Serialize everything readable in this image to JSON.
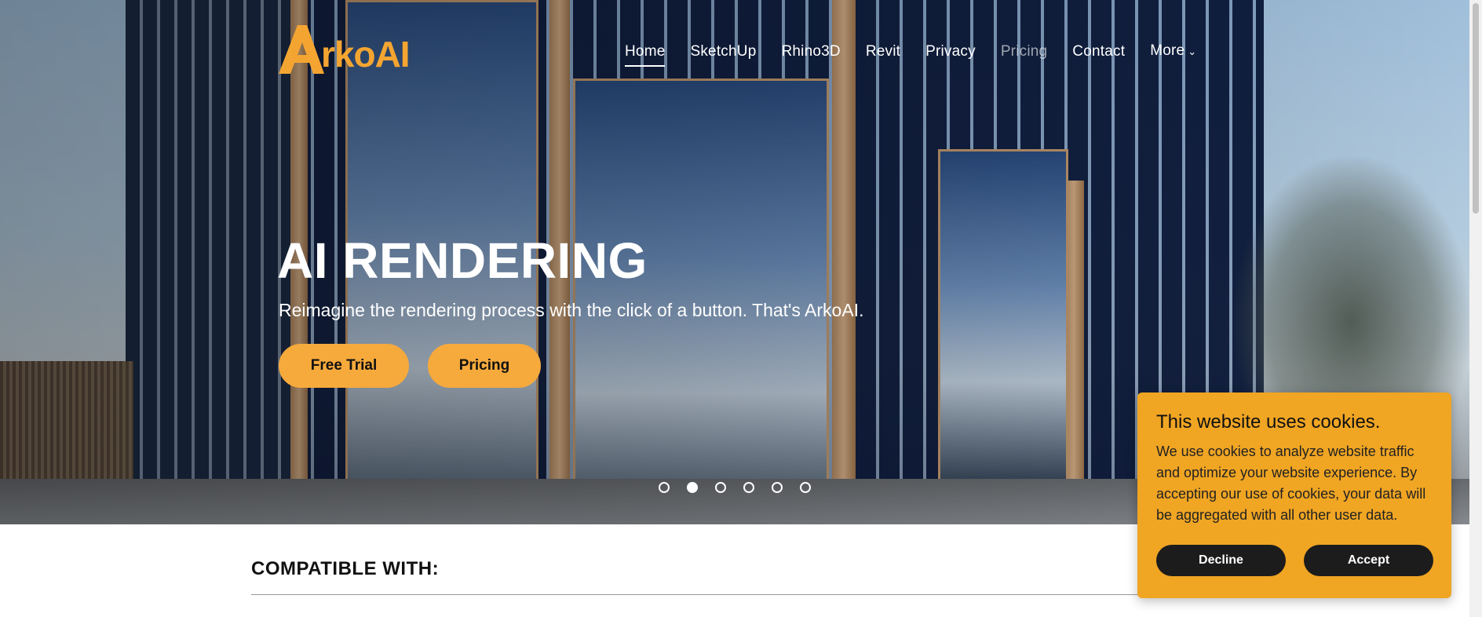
{
  "brand": {
    "name": "ArkoAI",
    "logo_text": "rkoAI",
    "accent": "#f4a531"
  },
  "nav": {
    "items": [
      {
        "label": "Home",
        "active": true
      },
      {
        "label": "SketchUp"
      },
      {
        "label": "Rhino3D"
      },
      {
        "label": "Revit"
      },
      {
        "label": "Privacy"
      },
      {
        "label": "Pricing"
      },
      {
        "label": "Contact"
      },
      {
        "label": "More",
        "icon": "chevron-down-icon"
      }
    ]
  },
  "hero": {
    "headline": "AI RENDERING",
    "subtitle": "Reimagine the rendering process with the click of a button. That's ArkoAI.",
    "buttons": {
      "trial": "Free Trial",
      "pricing": "Pricing"
    },
    "button_color": "#f6aa3c",
    "carousel": {
      "total": 6,
      "active_index": 2
    }
  },
  "compatible": {
    "heading": "COMPATIBLE WITH:"
  },
  "cookie_banner": {
    "title": "This website uses cookies.",
    "body": "We use cookies to analyze website traffic and optimize your website experience. By accepting our use of cookies, your data will be aggregated with all other user data.",
    "decline": "Decline",
    "accept": "Accept",
    "background": "#f0a523"
  }
}
